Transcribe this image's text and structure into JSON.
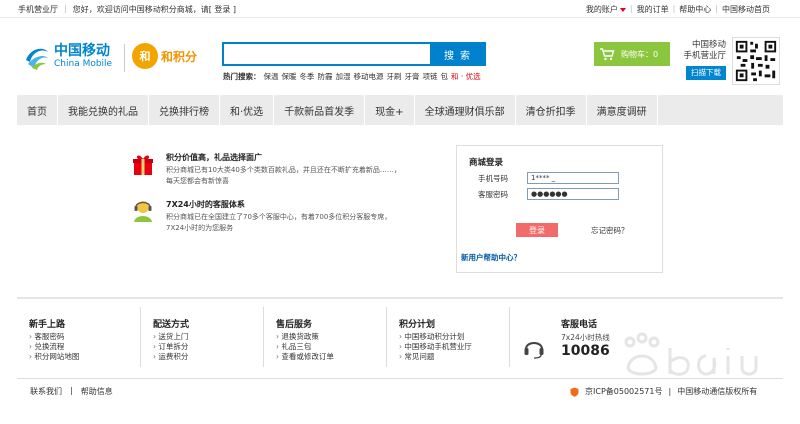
{
  "topbar": {
    "hall": "手机营业厅",
    "welcome": "您好，欢迎访问中国移动积分商城，请[ 登录 ]",
    "my_account": "我的账户",
    "my_orders": "我的订单",
    "help": "帮助中心",
    "home": "中国移动首页"
  },
  "header": {
    "cm_cn": "中国移动",
    "cm_en": "China Mobile",
    "hjf_badge": "和",
    "hjf_text": "和积分",
    "search_btn": "搜索",
    "search_placeholder": "",
    "hot_label": "热门搜索：",
    "hot_words": [
      "保温",
      "保暖",
      "冬季",
      "防霾",
      "加湿",
      "移动电源",
      "牙刷",
      "牙膏",
      "项链",
      "包"
    ],
    "hot_red": "和 · 优选",
    "cart": "购物车：0",
    "hall_line1": "中国移动",
    "hall_line2": "手机营业厅",
    "scan": "扫描下载"
  },
  "nav": [
    "首页",
    "我能兑换的礼品",
    "兑换排行榜",
    "和·优选",
    "千款新品首发季",
    "现金+",
    "全球通理财俱乐部",
    "清仓折扣季",
    "满意度调研"
  ],
  "features": [
    {
      "title": "积分价值高，礼品选择面广",
      "line1": "积分商城已有10大类40多个类数百款礼品，并且还在不断扩充着新品……，",
      "line2": "每天您都会有新惊喜"
    },
    {
      "title": "7X24小时的客服体系",
      "line1": "积分商城已在全国建立了70多个客服中心，有着700多位积分客服专席，",
      "line2": "7X24小时的为您服务"
    }
  ],
  "login": {
    "title": "商城登录",
    "phone_label": "手机号码",
    "phone_value": "1****  _",
    "pwd_label": "客服密码",
    "pwd_value": "●●●●●●",
    "submit": "登录",
    "forgot": "忘记密码？",
    "help": "新用户帮助中心？"
  },
  "footer_cols": [
    {
      "title": "新手上路",
      "items": [
        "客服密码",
        "兑换流程",
        "积分网站地图"
      ]
    },
    {
      "title": "配送方式",
      "items": [
        "送货上门",
        "订单拆分",
        "运费积分"
      ]
    },
    {
      "title": "售后服务",
      "items": [
        "退换货政策",
        "礼品三包",
        "查看或修改订单"
      ]
    },
    {
      "title": "积分计划",
      "items": [
        "中国移动积分计划",
        "中国移动手机营业厅",
        "常见问题"
      ]
    }
  ],
  "phone": {
    "title": "客服电话",
    "sub": "7x24小时热线",
    "number": "10086"
  },
  "bottom": {
    "contact": "联系我们",
    "sep": "|",
    "info": "帮助信息",
    "icp": "京ICP备05002571号",
    "company": "中国移动通信版权所有"
  },
  "colors": {
    "brand_blue": "#0081cc",
    "cart_green": "#8cc63f",
    "accent_red": "#e60012"
  }
}
